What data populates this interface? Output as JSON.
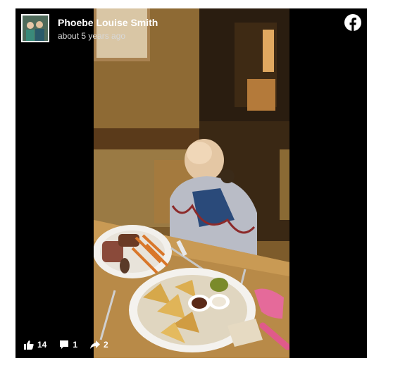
{
  "post": {
    "author_name": "Phoebe Louise Smith",
    "timestamp": "about 5 years ago"
  },
  "icons": {
    "brand": "facebook-icon",
    "like": "thumbs-up-icon",
    "comment": "comment-icon",
    "share": "share-icon"
  },
  "stats": {
    "likes": "14",
    "comments": "1",
    "shares": "2"
  },
  "colors": {
    "background": "#000000",
    "text": "#ffffff",
    "page": "#ffffff"
  }
}
